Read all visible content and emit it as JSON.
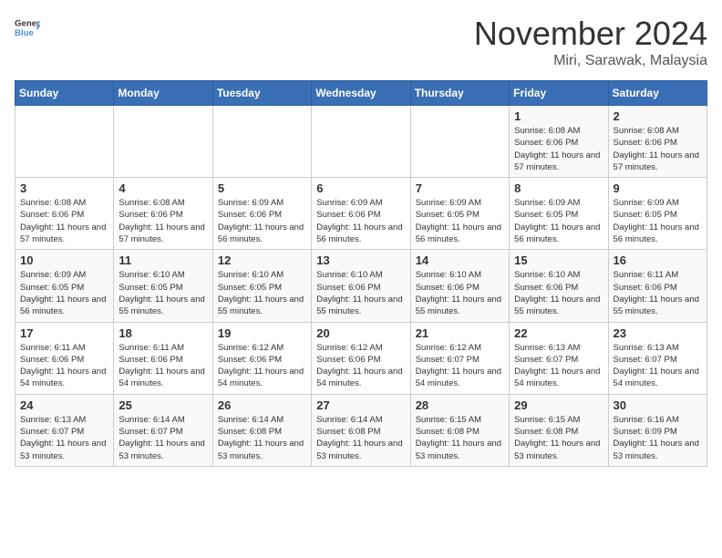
{
  "logo": {
    "general": "General",
    "blue": "Blue"
  },
  "title": "November 2024",
  "location": "Miri, Sarawak, Malaysia",
  "headers": [
    "Sunday",
    "Monday",
    "Tuesday",
    "Wednesday",
    "Thursday",
    "Friday",
    "Saturday"
  ],
  "weeks": [
    [
      {
        "day": "",
        "info": ""
      },
      {
        "day": "",
        "info": ""
      },
      {
        "day": "",
        "info": ""
      },
      {
        "day": "",
        "info": ""
      },
      {
        "day": "",
        "info": ""
      },
      {
        "day": "1",
        "info": "Sunrise: 6:08 AM\nSunset: 6:06 PM\nDaylight: 11 hours and 57 minutes."
      },
      {
        "day": "2",
        "info": "Sunrise: 6:08 AM\nSunset: 6:06 PM\nDaylight: 11 hours and 57 minutes."
      }
    ],
    [
      {
        "day": "3",
        "info": "Sunrise: 6:08 AM\nSunset: 6:06 PM\nDaylight: 11 hours and 57 minutes."
      },
      {
        "day": "4",
        "info": "Sunrise: 6:08 AM\nSunset: 6:06 PM\nDaylight: 11 hours and 57 minutes."
      },
      {
        "day": "5",
        "info": "Sunrise: 6:09 AM\nSunset: 6:06 PM\nDaylight: 11 hours and 56 minutes."
      },
      {
        "day": "6",
        "info": "Sunrise: 6:09 AM\nSunset: 6:06 PM\nDaylight: 11 hours and 56 minutes."
      },
      {
        "day": "7",
        "info": "Sunrise: 6:09 AM\nSunset: 6:05 PM\nDaylight: 11 hours and 56 minutes."
      },
      {
        "day": "8",
        "info": "Sunrise: 6:09 AM\nSunset: 6:05 PM\nDaylight: 11 hours and 56 minutes."
      },
      {
        "day": "9",
        "info": "Sunrise: 6:09 AM\nSunset: 6:05 PM\nDaylight: 11 hours and 56 minutes."
      }
    ],
    [
      {
        "day": "10",
        "info": "Sunrise: 6:09 AM\nSunset: 6:05 PM\nDaylight: 11 hours and 56 minutes."
      },
      {
        "day": "11",
        "info": "Sunrise: 6:10 AM\nSunset: 6:05 PM\nDaylight: 11 hours and 55 minutes."
      },
      {
        "day": "12",
        "info": "Sunrise: 6:10 AM\nSunset: 6:05 PM\nDaylight: 11 hours and 55 minutes."
      },
      {
        "day": "13",
        "info": "Sunrise: 6:10 AM\nSunset: 6:06 PM\nDaylight: 11 hours and 55 minutes."
      },
      {
        "day": "14",
        "info": "Sunrise: 6:10 AM\nSunset: 6:06 PM\nDaylight: 11 hours and 55 minutes."
      },
      {
        "day": "15",
        "info": "Sunrise: 6:10 AM\nSunset: 6:06 PM\nDaylight: 11 hours and 55 minutes."
      },
      {
        "day": "16",
        "info": "Sunrise: 6:11 AM\nSunset: 6:06 PM\nDaylight: 11 hours and 55 minutes."
      }
    ],
    [
      {
        "day": "17",
        "info": "Sunrise: 6:11 AM\nSunset: 6:06 PM\nDaylight: 11 hours and 54 minutes."
      },
      {
        "day": "18",
        "info": "Sunrise: 6:11 AM\nSunset: 6:06 PM\nDaylight: 11 hours and 54 minutes."
      },
      {
        "day": "19",
        "info": "Sunrise: 6:12 AM\nSunset: 6:06 PM\nDaylight: 11 hours and 54 minutes."
      },
      {
        "day": "20",
        "info": "Sunrise: 6:12 AM\nSunset: 6:06 PM\nDaylight: 11 hours and 54 minutes."
      },
      {
        "day": "21",
        "info": "Sunrise: 6:12 AM\nSunset: 6:07 PM\nDaylight: 11 hours and 54 minutes."
      },
      {
        "day": "22",
        "info": "Sunrise: 6:13 AM\nSunset: 6:07 PM\nDaylight: 11 hours and 54 minutes."
      },
      {
        "day": "23",
        "info": "Sunrise: 6:13 AM\nSunset: 6:07 PM\nDaylight: 11 hours and 54 minutes."
      }
    ],
    [
      {
        "day": "24",
        "info": "Sunrise: 6:13 AM\nSunset: 6:07 PM\nDaylight: 11 hours and 53 minutes."
      },
      {
        "day": "25",
        "info": "Sunrise: 6:14 AM\nSunset: 6:07 PM\nDaylight: 11 hours and 53 minutes."
      },
      {
        "day": "26",
        "info": "Sunrise: 6:14 AM\nSunset: 6:08 PM\nDaylight: 11 hours and 53 minutes."
      },
      {
        "day": "27",
        "info": "Sunrise: 6:14 AM\nSunset: 6:08 PM\nDaylight: 11 hours and 53 minutes."
      },
      {
        "day": "28",
        "info": "Sunrise: 6:15 AM\nSunset: 6:08 PM\nDaylight: 11 hours and 53 minutes."
      },
      {
        "day": "29",
        "info": "Sunrise: 6:15 AM\nSunset: 6:08 PM\nDaylight: 11 hours and 53 minutes."
      },
      {
        "day": "30",
        "info": "Sunrise: 6:16 AM\nSunset: 6:09 PM\nDaylight: 11 hours and 53 minutes."
      }
    ]
  ]
}
